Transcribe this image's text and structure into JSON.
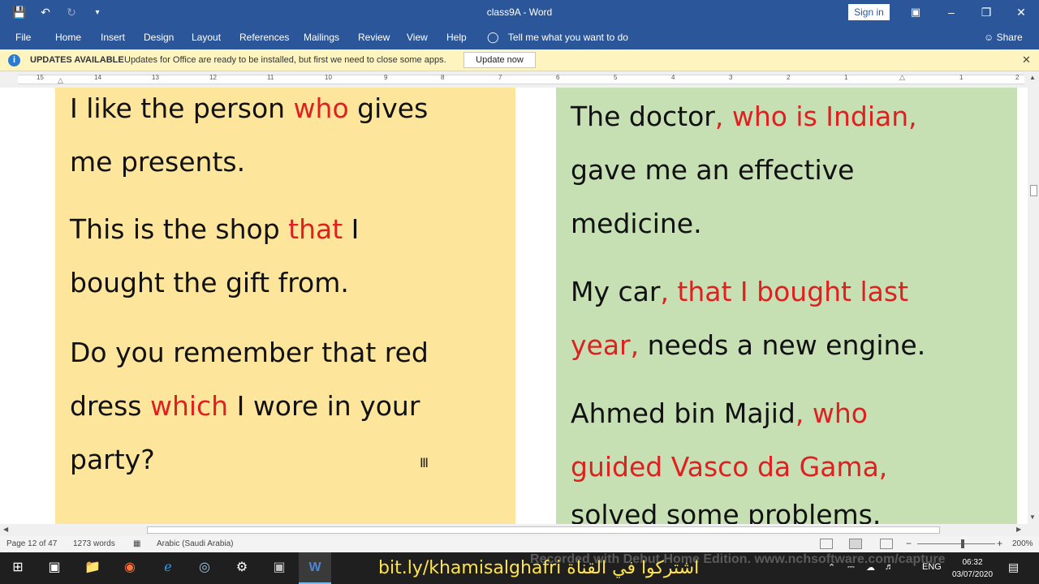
{
  "window": {
    "title": "class9A - Word",
    "sign_in": "Sign in",
    "minimize": "–",
    "restore": "❐",
    "close": "✕"
  },
  "qat": {
    "save_icon": "save-icon",
    "undo_icon": "undo-icon",
    "redo_icon": "redo-icon",
    "customize_icon": "customize-qat-icon"
  },
  "ribbon": {
    "tabs": [
      "File",
      "Home",
      "Insert",
      "Design",
      "Layout",
      "References",
      "Mailings",
      "Review",
      "View",
      "Help"
    ],
    "tell_me": "Tell me what you want to do",
    "share": "Share"
  },
  "message_bar": {
    "title": "UPDATES AVAILABLE",
    "text": "Updates for Office are ready to be installed, but first we need to close some apps.",
    "button": "Update now"
  },
  "ruler": {
    "numbers": [
      "15",
      "14",
      "13",
      "12",
      "11",
      "10",
      "9",
      "8",
      "7",
      "6",
      "5",
      "4",
      "3",
      "2",
      "1",
      "1",
      "2"
    ]
  },
  "document": {
    "left_column": [
      {
        "parts": [
          {
            "t": "I like the person ",
            "red": false
          },
          {
            "t": "who",
            "red": true
          },
          {
            "t": " gives",
            "red": false
          }
        ]
      },
      {
        "parts": [
          {
            "t": "me presents.",
            "red": false
          }
        ]
      },
      {
        "parts": [
          {
            "t": "This is the shop ",
            "red": false
          },
          {
            "t": "that",
            "red": true
          },
          {
            "t": " I",
            "red": false
          }
        ]
      },
      {
        "parts": [
          {
            "t": "bought the gift from.",
            "red": false
          }
        ]
      },
      {
        "parts": [
          {
            "t": "Do you remember that red",
            "red": false
          }
        ]
      },
      {
        "parts": [
          {
            "t": "dress ",
            "red": false
          },
          {
            "t": "which",
            "red": true
          },
          {
            "t": " I wore in your",
            "red": false
          }
        ]
      },
      {
        "parts": [
          {
            "t": "party?",
            "red": false
          }
        ]
      }
    ],
    "right_column": [
      {
        "parts": [
          {
            "t": "The doctor",
            "red": false
          },
          {
            "t": ", who is Indian,",
            "red": true
          }
        ]
      },
      {
        "parts": [
          {
            "t": "gave me an effective",
            "red": false
          }
        ]
      },
      {
        "parts": [
          {
            "t": "medicine.",
            "red": false
          }
        ]
      },
      {
        "parts": [
          {
            "t": "My car",
            "red": false
          },
          {
            "t": ", that I bought last",
            "red": true
          }
        ]
      },
      {
        "parts": [
          {
            "t": "year,",
            "red": true
          },
          {
            "t": " needs a new engine.",
            "red": false
          }
        ]
      },
      {
        "parts": [
          {
            "t": "Ahmed bin Majid",
            "red": false
          },
          {
            "t": ", who",
            "red": true
          }
        ]
      },
      {
        "parts": [
          {
            "t": "guided Vasco da Gama,",
            "red": true
          }
        ]
      },
      {
        "parts": [
          {
            "t": "solved some problems.",
            "red": false
          }
        ]
      }
    ]
  },
  "status_bar": {
    "page": "Page 12 of 47",
    "words": "1273 words",
    "language": "Arabic (Saudi Arabia)",
    "zoom_minus": "−",
    "zoom_plus": "+",
    "zoom": "200%",
    "zoom_fraction": 0.58
  },
  "taskbar": {
    "promo": "bit.ly/khamisalghafri اشتركوا في القناة",
    "watermark": "Recorded with Debut Home Edition. www.nchsoftware.com/capture",
    "language": "ENG",
    "time": "06:32",
    "date": "03/07/2020"
  },
  "colors": {
    "ribbon_blue": "#2b579a",
    "left_panel": "#fde69c",
    "right_panel": "#c6e0b4",
    "highlight_red": "#e02020",
    "message_bar": "#fdf4bf"
  }
}
